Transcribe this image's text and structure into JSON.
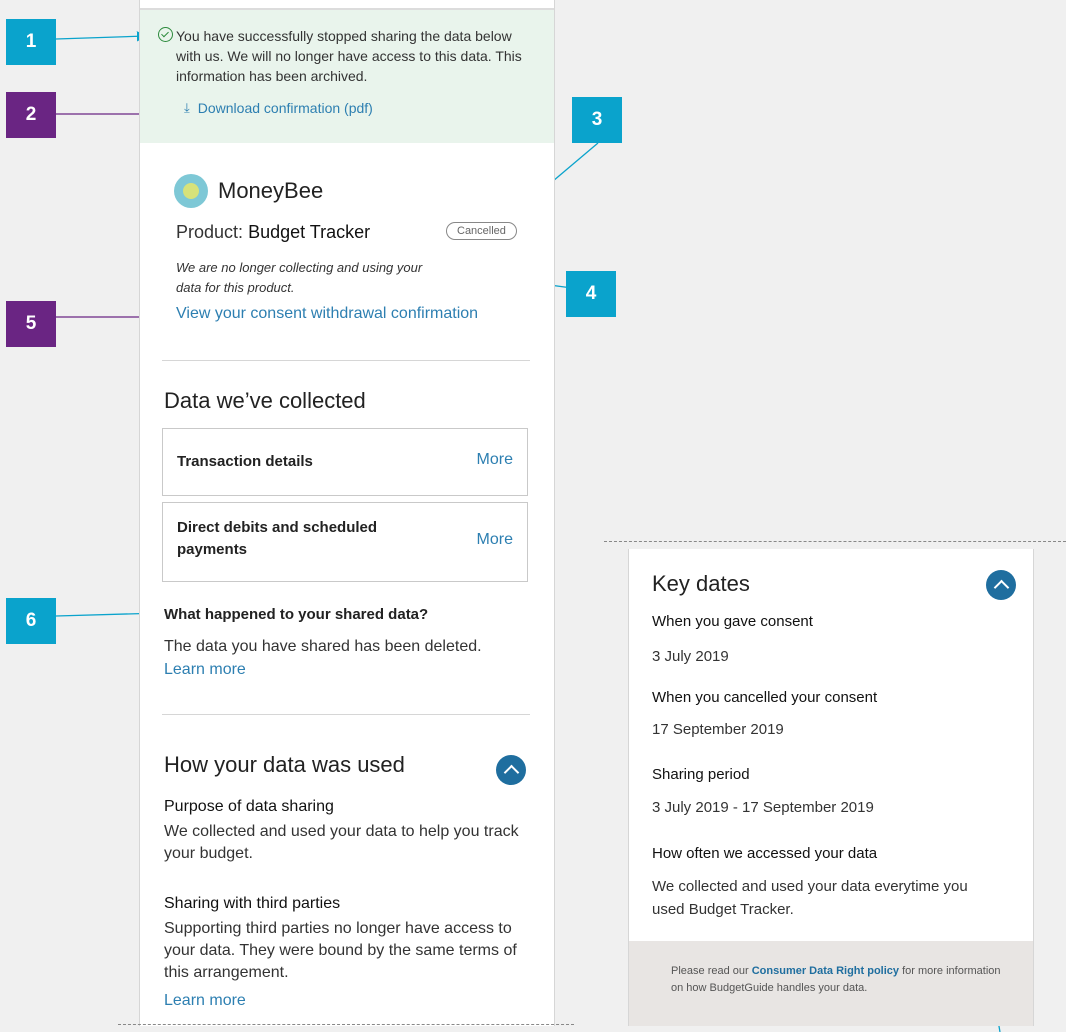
{
  "markers": [
    "1",
    "2",
    "3",
    "4",
    "5",
    "6"
  ],
  "banner": {
    "message": "You have successfully stopped sharing the data below with us. We will no longer have access to this data. This information has been archived.",
    "download_link": "Download confirmation (pdf)"
  },
  "product": {
    "brand": "MoneyBee",
    "label": "Product:",
    "name": "Budget Tracker",
    "status": "Cancelled",
    "note": "We are no longer collecting and using your data for this product.",
    "consent_link": "View your consent withdrawal confirmation"
  },
  "data_collected": {
    "heading": "Data we’ve collected",
    "items": [
      {
        "label": "Transaction details",
        "action": "More"
      },
      {
        "label": "Direct debits and scheduled payments",
        "action": "More"
      }
    ]
  },
  "shared_data": {
    "heading": "What happened to your shared data?",
    "text": "The data you have shared has been deleted.",
    "link": "Learn more"
  },
  "usage": {
    "heading": "How your data was used",
    "purpose_heading": "Purpose of data sharing",
    "purpose_text": "We collected and used your data to help you track your budget.",
    "third_heading": "Sharing with third parties",
    "third_text": "Supporting third parties no longer have access to your data. They were bound by the same terms of this arrangement.",
    "third_link": "Learn more"
  },
  "key_dates": {
    "heading": "Key dates",
    "items": [
      {
        "label": "When you gave consent",
        "value": "3 July 2019"
      },
      {
        "label": "When you cancelled your consent",
        "value": "17 September 2019"
      },
      {
        "label": "Sharing period",
        "value": "3 July 2019 - 17 September 2019"
      },
      {
        "label": "How often we accessed your data",
        "value": "We collected and used your data everytime you used Budget Tracker."
      }
    ],
    "footer_pre": "Please read our ",
    "footer_link": "Consumer Data Right policy",
    "footer_post": " for more information on how BudgetGuide handles your data."
  },
  "colors": {
    "marker_blue": "#0aa3cc",
    "marker_purple": "#6a2583",
    "link": "#2d7fb1",
    "banner_bg": "#e9f4ec",
    "accent_button": "#1f6e9f"
  }
}
